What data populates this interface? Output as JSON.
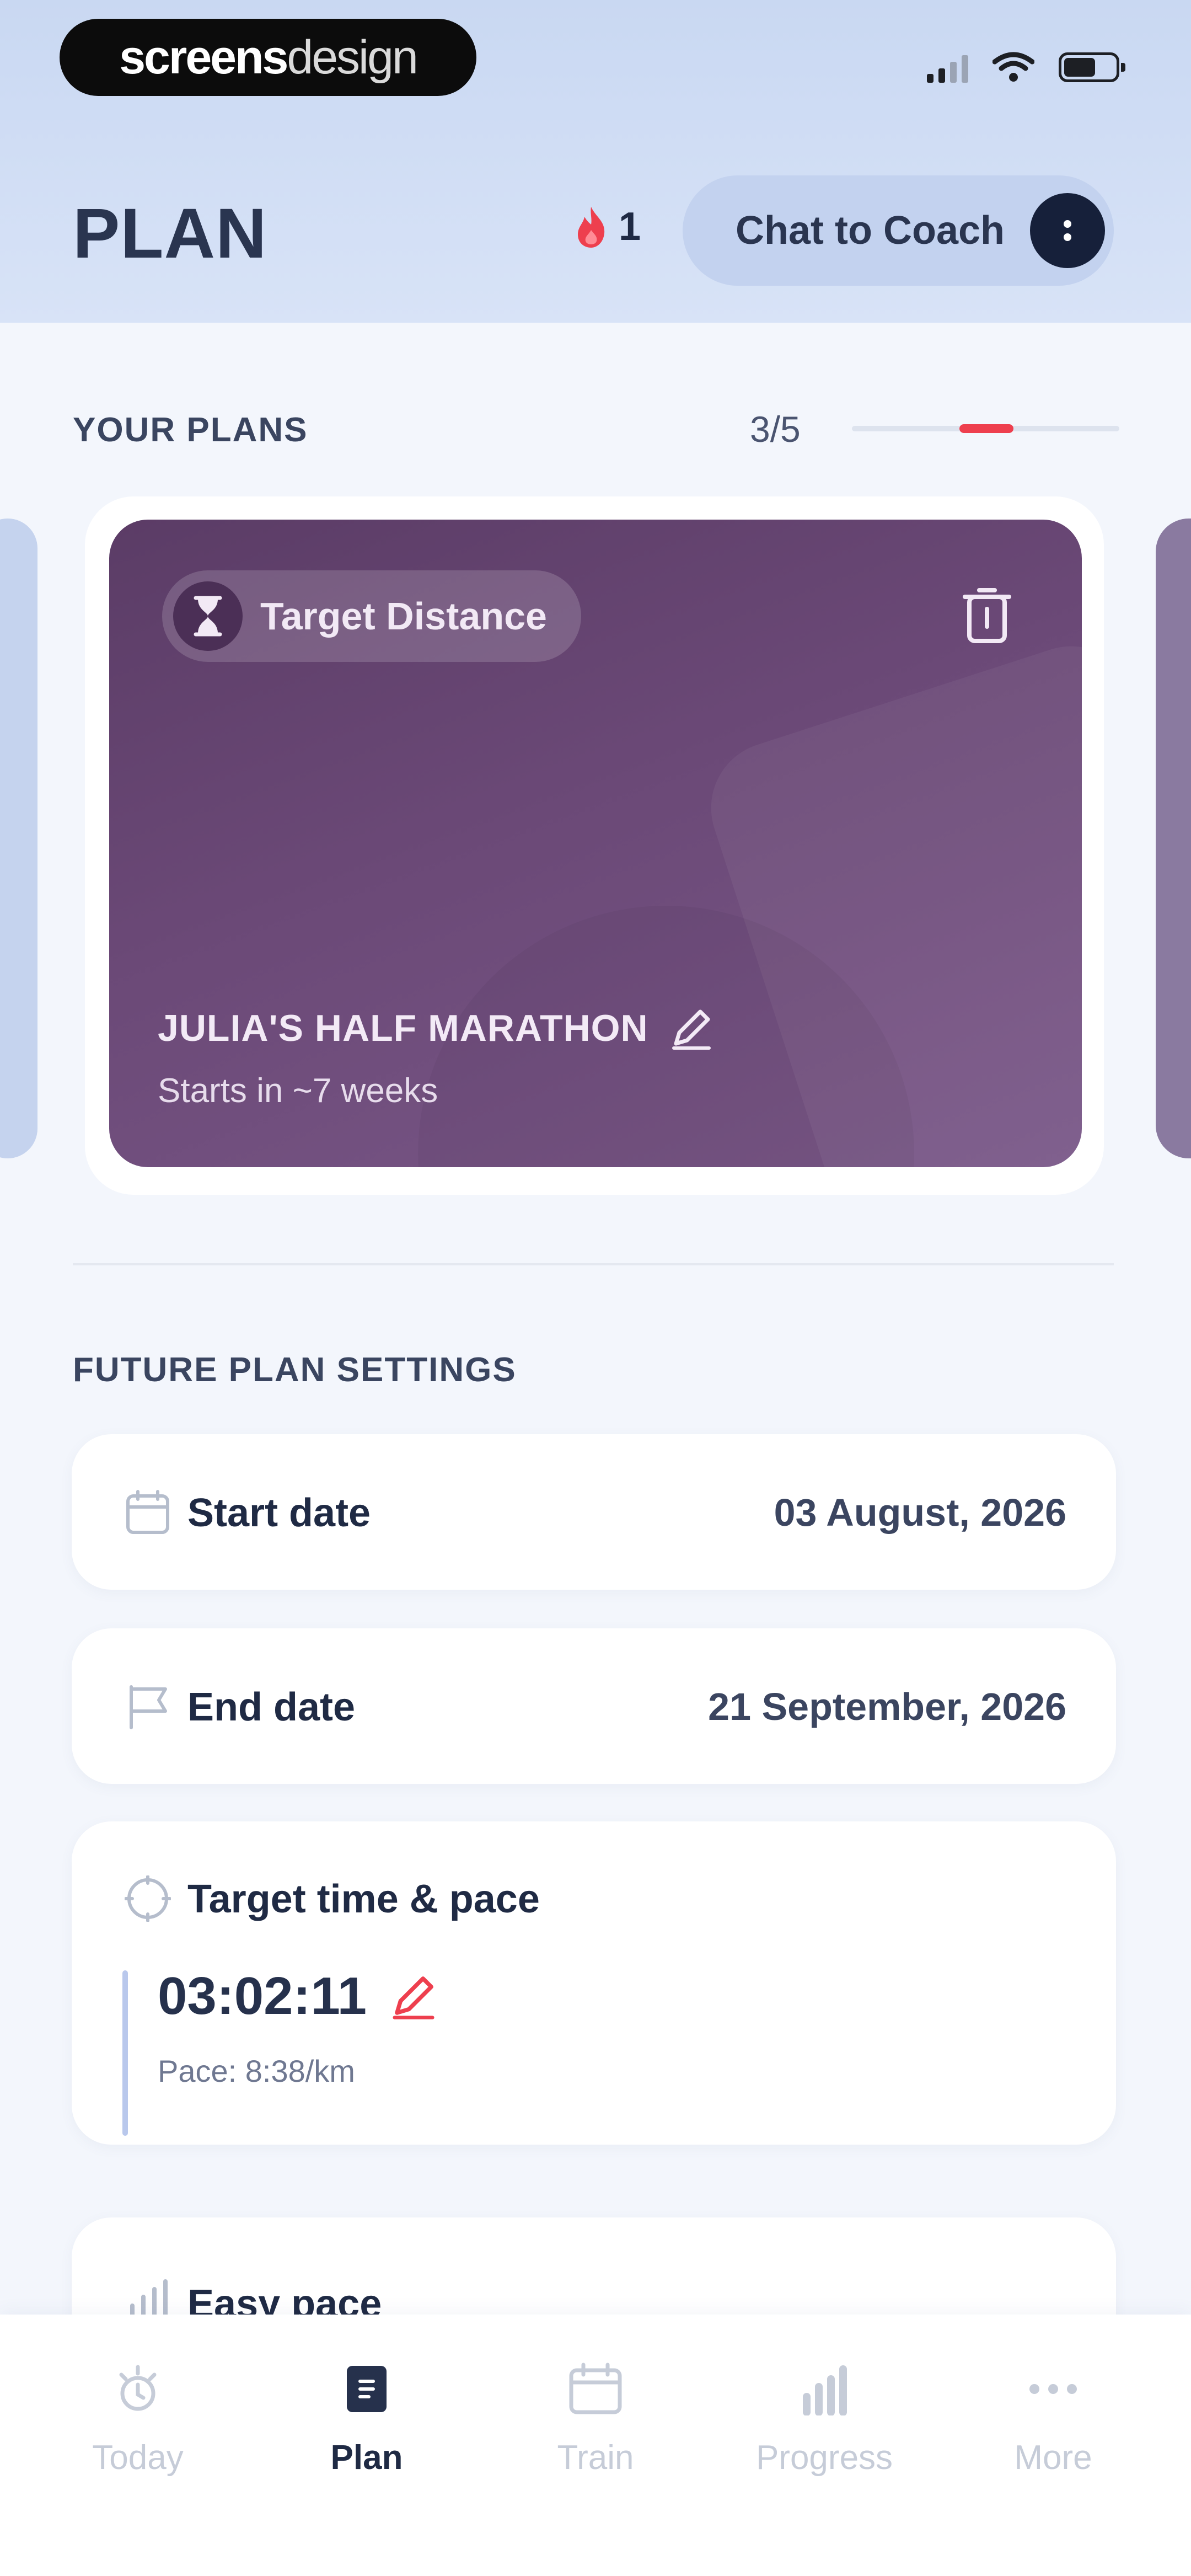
{
  "brand": {
    "part1": "screens",
    "part2": "design"
  },
  "header": {
    "title": "PLAN",
    "streak_count": "1",
    "coach_button": "Chat to Coach"
  },
  "plans": {
    "section_label": "YOUR PLANS",
    "counter": "3/5",
    "card": {
      "badge": "Target Distance",
      "name": "JULIA'S HALF MARATHON",
      "subtitle": "Starts in ~7 weeks"
    }
  },
  "settings": {
    "section_label": "FUTURE PLAN SETTINGS",
    "start_date": {
      "label": "Start date",
      "value": "03 August, 2026"
    },
    "end_date": {
      "label": "End date",
      "value": "21 September, 2026"
    },
    "target": {
      "label": "Target time & pace",
      "time": "03:02:11",
      "pace": "Pace: 8:38/km"
    },
    "easy_pace": {
      "label": "Easy pace"
    }
  },
  "nav": [
    {
      "label": "Today",
      "icon": "today-icon",
      "active": false
    },
    {
      "label": "Plan",
      "icon": "plan-icon",
      "active": true
    },
    {
      "label": "Train",
      "icon": "calendar-icon",
      "active": false
    },
    {
      "label": "Progress",
      "icon": "chart-icon",
      "active": false
    },
    {
      "label": "More",
      "icon": "more-icon",
      "active": false
    }
  ],
  "colors": {
    "accent": "#ee3f4e",
    "card_purple": "#6b4977",
    "header_bg": "#c9d8f2",
    "coach_pill": "#c3d2ef",
    "text_dark": "#1f2a44"
  }
}
